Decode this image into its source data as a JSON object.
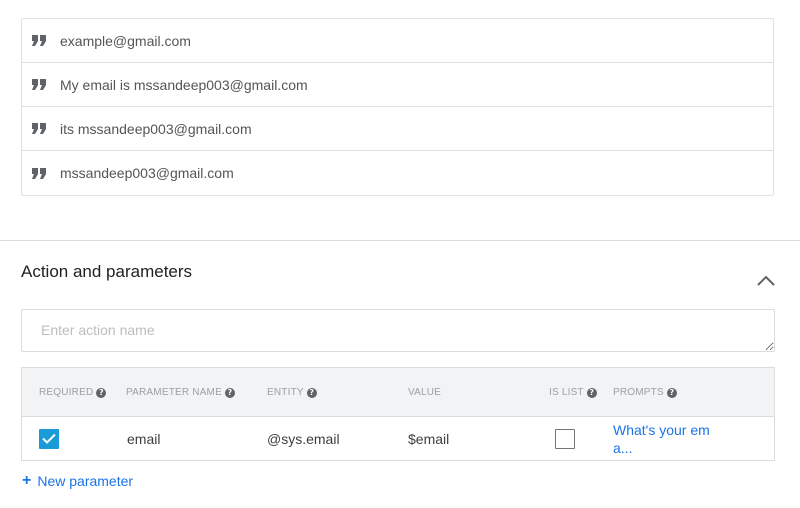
{
  "training_phrases": [
    {
      "text": "example@gmail.com"
    },
    {
      "text": "My email is mssandeep003@gmail.com"
    },
    {
      "text": "its mssandeep003@gmail.com"
    },
    {
      "text": "mssandeep003@gmail.com"
    }
  ],
  "action_section": {
    "title": "Action and parameters",
    "action_input": {
      "placeholder": "Enter action name",
      "value": ""
    }
  },
  "parameters_table": {
    "headers": {
      "required": "REQUIRED",
      "parameter_name": "PARAMETER NAME",
      "entity": "ENTITY",
      "value": "VALUE",
      "is_list": "IS LIST",
      "prompts": "PROMPTS"
    },
    "rows": [
      {
        "required": true,
        "parameter_name": "email",
        "entity": "@sys.email",
        "value": "$email",
        "is_list": false,
        "prompt_line1": "What's your em",
        "prompt_line2": "a..."
      }
    ]
  },
  "new_parameter_label": "New parameter",
  "icons": {
    "quote": "quote-icon",
    "collapse": "chevron-up-icon",
    "help": "help-circle-icon",
    "check": "check-icon",
    "plus": "plus-icon"
  },
  "colors": {
    "accent": "#1a73e8",
    "checkbox": "#1a9bd7",
    "header_bg": "#f1f3f4",
    "border": "#dadce0"
  }
}
